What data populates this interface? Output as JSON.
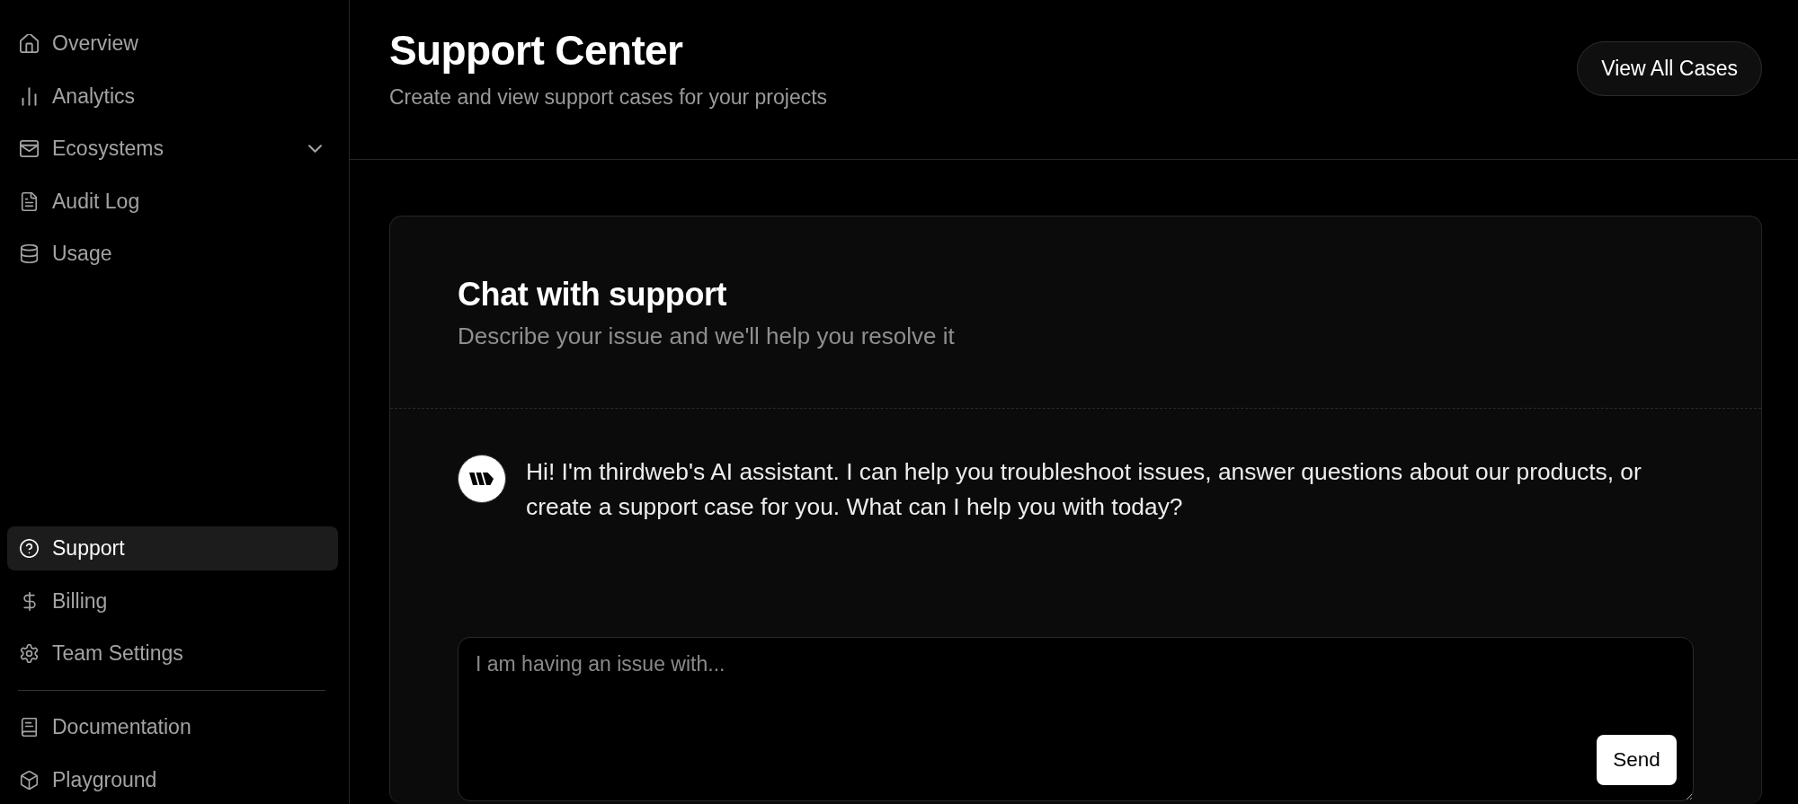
{
  "sidebar": {
    "nav_items": [
      {
        "label": "Overview",
        "selected": false
      },
      {
        "label": "Analytics",
        "selected": false
      },
      {
        "label": "Ecosystems",
        "selected": false,
        "expanded": false
      },
      {
        "label": "Audit Log",
        "selected": false
      },
      {
        "label": "Usage",
        "selected": false
      }
    ],
    "account_items": [
      {
        "label": "Support",
        "selected": true
      },
      {
        "label": "Billing",
        "selected": false
      },
      {
        "label": "Team Settings",
        "selected": false
      }
    ],
    "resource_items": [
      {
        "label": "Documentation",
        "selected": false
      },
      {
        "label": "Playground",
        "selected": false
      }
    ]
  },
  "header": {
    "title": "Support Center",
    "subtitle": "Create and view support cases for your projects",
    "action_button": "View All Cases"
  },
  "chat": {
    "title": "Chat with support",
    "subtitle": "Describe your issue and we'll help you resolve it",
    "messages": [
      {
        "kind": "assistant",
        "text": "Hi! I'm thirdweb's AI assistant. I can help you troubleshoot issues, answer questions about our products, or create a support case for you. What can I help you with today?"
      }
    ],
    "input": {
      "placeholder": "I am having an issue with..."
    },
    "send_button": "Send"
  }
}
